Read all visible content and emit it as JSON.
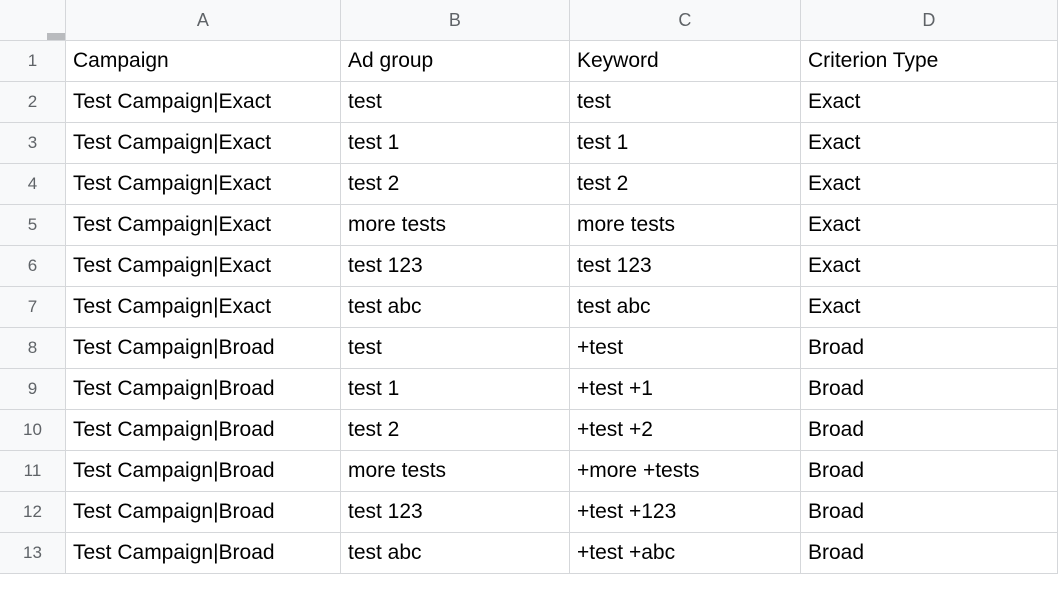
{
  "sheet": {
    "columns": [
      "A",
      "B",
      "C",
      "D"
    ],
    "rowNumbers": [
      "1",
      "2",
      "3",
      "4",
      "5",
      "6",
      "7",
      "8",
      "9",
      "10",
      "11",
      "12",
      "13"
    ],
    "rows": [
      {
        "A": "Campaign",
        "B": "Ad group",
        "C": "Keyword",
        "D": "Criterion Type"
      },
      {
        "A": "Test Campaign|Exact",
        "B": "test",
        "C": "test",
        "D": "Exact"
      },
      {
        "A": "Test Campaign|Exact",
        "B": "test 1",
        "C": "test 1",
        "D": "Exact"
      },
      {
        "A": "Test Campaign|Exact",
        "B": "test 2",
        "C": "test 2",
        "D": "Exact"
      },
      {
        "A": "Test Campaign|Exact",
        "B": "more tests",
        "C": "more tests",
        "D": "Exact"
      },
      {
        "A": "Test Campaign|Exact",
        "B": "test 123",
        "C": "test 123",
        "D": "Exact"
      },
      {
        "A": "Test Campaign|Exact",
        "B": "test abc",
        "C": "test abc",
        "D": "Exact"
      },
      {
        "A": "Test Campaign|Broad",
        "B": "test",
        "C": "+test",
        "D": "Broad"
      },
      {
        "A": "Test Campaign|Broad",
        "B": "test 1",
        "C": "+test +1",
        "D": "Broad"
      },
      {
        "A": "Test Campaign|Broad",
        "B": "test 2",
        "C": "+test +2",
        "D": "Broad"
      },
      {
        "A": "Test Campaign|Broad",
        "B": "more tests",
        "C": "+more +tests",
        "D": "Broad"
      },
      {
        "A": "Test Campaign|Broad",
        "B": "test 123",
        "C": "+test +123",
        "D": "Broad"
      },
      {
        "A": "Test Campaign|Broad",
        "B": "test abc",
        "C": "+test +abc",
        "D": "Broad"
      }
    ]
  }
}
